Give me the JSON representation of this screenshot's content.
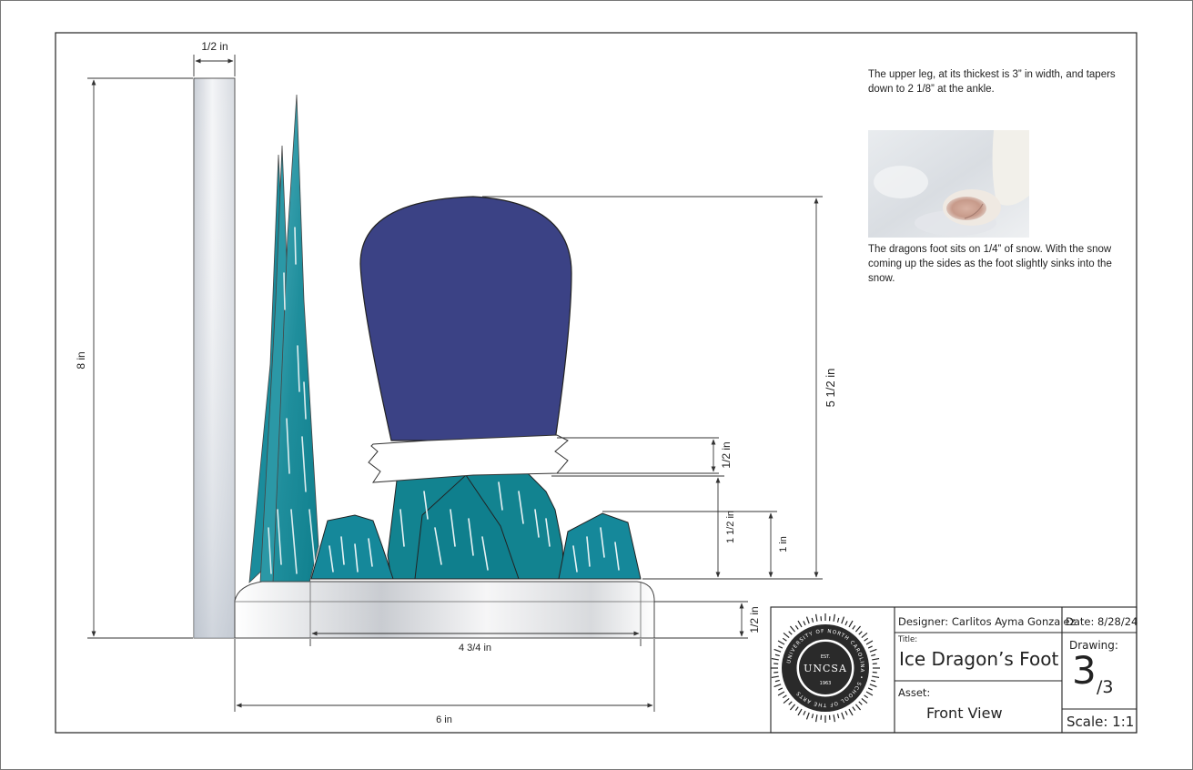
{
  "dimensions": {
    "wall_width": "1/2 in",
    "wall_height": "8 in",
    "leg_height": "5 1/2 in",
    "band_height": "1/2 in",
    "ankle_height": "1 1/2 in",
    "rock_height": "1 in",
    "base_height": "1/2 in",
    "base_inner_width": "4 3/4 in",
    "base_width": "6 in"
  },
  "notes": {
    "upper_leg": "The upper leg, at its thickest is 3” in width, and tapers down to 2 1/8” at the ankle.",
    "snow": "The dragons foot sits on 1/4” of snow.  With the snow coming up the sides as the foot slightly sinks into the snow."
  },
  "logo": {
    "ring_text": "UNIVERSITY OF NORTH CAROLINA • SCHOOL OF THE ARTS",
    "est": "EST.",
    "name": "UNCSA",
    "year": "1963"
  },
  "title_block": {
    "designer": "Designer: Carlitos Ayma Gonzalez",
    "date": "Date: 8/28/24",
    "title_label": "Title:",
    "title": "Ice Dragon’s Foot",
    "drawing_label": "Drawing:",
    "drawing_number": "3",
    "drawing_total": "/3",
    "asset_label": "Asset:",
    "asset": "Front View",
    "scale": "Scale: 1:1"
  },
  "colors": {
    "leg": "#3b4285",
    "ice": "#1a8c9c",
    "ice_light": "#5bb8c4",
    "rock": "#128390",
    "dim_line": "#333333"
  }
}
